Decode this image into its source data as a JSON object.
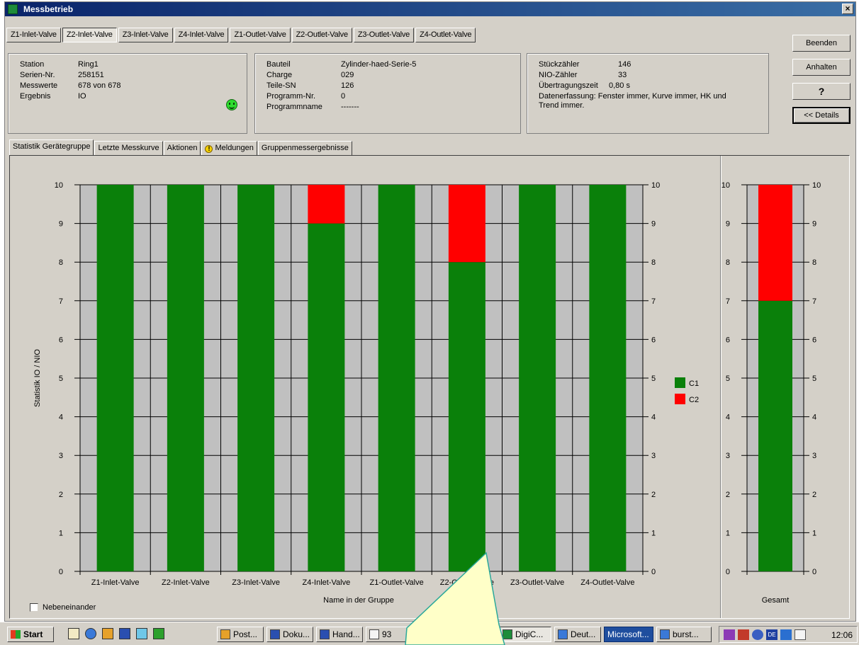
{
  "window": {
    "title": "Messbetrieb",
    "close_label": "×"
  },
  "top_tabs": [
    {
      "label": "Z1-Inlet-Valve",
      "active": false
    },
    {
      "label": "Z2-Inlet-Valve",
      "active": true
    },
    {
      "label": "Z3-Inlet-Valve",
      "active": false
    },
    {
      "label": "Z4-Inlet-Valve",
      "active": false
    },
    {
      "label": "Z1-Outlet-Valve",
      "active": false
    },
    {
      "label": "Z2-Outlet-Valve",
      "active": false
    },
    {
      "label": "Z3-Outlet-Valve",
      "active": false
    },
    {
      "label": "Z4-Outlet-Valve",
      "active": false
    }
  ],
  "buttons": {
    "beenden": "Beenden",
    "anhalten": "Anhalten",
    "help": "?",
    "details": "<< Details"
  },
  "info1": {
    "station_label": "Station",
    "station": "Ring1",
    "serial_label": "Serien-Nr.",
    "serial": "258151",
    "values_label": "Messwerte",
    "values": "678 von 678",
    "result_label": "Ergebnis",
    "result": "IO"
  },
  "info2": {
    "part_label": "Bauteil",
    "part": "Zylinder-haed-Serie-5",
    "batch_label": "Charge",
    "batch": "029",
    "sn_label": "Teile-SN",
    "sn": "126",
    "prog_nr_label": "Programm-Nr.",
    "prog_nr": "0",
    "prog_name_label": "Programmname",
    "prog_name": "-------"
  },
  "info3": {
    "count_label": "Stückzähler",
    "count": "146",
    "nio_label": "NIO-Zähler",
    "nio": "33",
    "transfer_label": "Übertragungszeit",
    "transfer": "0,80 s",
    "capture_line1": "Datenerfassung: Fenster immer, Kurve immer, HK und",
    "capture_line2": "Trend immer."
  },
  "mid_tabs": [
    {
      "label": "Statistik Gerätegruppe",
      "active": true
    },
    {
      "label": "Letzte Messkurve",
      "active": false
    },
    {
      "label": "Aktionen",
      "active": false
    },
    {
      "label": "Meldungen",
      "active": false,
      "icon": "warning-icon"
    },
    {
      "label": "Gruppenmessergebnisse",
      "active": false
    }
  ],
  "checkbox": {
    "label": "Nebeneinander",
    "checked": false
  },
  "chart_data": [
    {
      "type": "bar",
      "stacked": true,
      "categories": [
        "Z1-Inlet-Valve",
        "Z2-Inlet-Valve",
        "Z3-Inlet-Valve",
        "Z4-Inlet-Valve",
        "Z1-Outlet-Valve",
        "Z2-Outlet-Valve",
        "Z3-Outlet-Valve",
        "Z4-Outlet-Valve"
      ],
      "series": [
        {
          "name": "C1",
          "color": "#0a800a",
          "values": [
            10,
            10,
            10,
            9,
            10,
            8,
            10,
            10
          ]
        },
        {
          "name": "C2",
          "color": "#ff0000",
          "values": [
            0,
            0,
            0,
            1,
            0,
            2,
            0,
            0
          ]
        }
      ],
      "xlabel": "Name in der Gruppe",
      "ylabel": "Statistik IO / NIO",
      "ylim": [
        0,
        10
      ],
      "yticks": [
        0,
        1,
        2,
        3,
        4,
        5,
        6,
        7,
        8,
        9,
        10
      ],
      "grid": true,
      "legend": "right"
    },
    {
      "type": "bar",
      "stacked": true,
      "categories": [
        "Gesamt"
      ],
      "series": [
        {
          "name": "C1",
          "color": "#0a800a",
          "values": [
            7
          ]
        },
        {
          "name": "C2",
          "color": "#ff0000",
          "values": [
            3
          ]
        }
      ],
      "xlabel": "Gesamt",
      "ylim": [
        0,
        10
      ],
      "yticks": [
        0,
        1,
        2,
        3,
        4,
        5,
        6,
        7,
        8,
        9,
        10
      ],
      "grid": true
    }
  ],
  "taskbar": {
    "start": "Start",
    "tasks": [
      "Post...",
      "Doku...",
      "Hand...",
      "93",
      "DigiC...",
      "Deut...",
      "Microsoft...",
      "burst..."
    ],
    "clock": "12:06"
  }
}
